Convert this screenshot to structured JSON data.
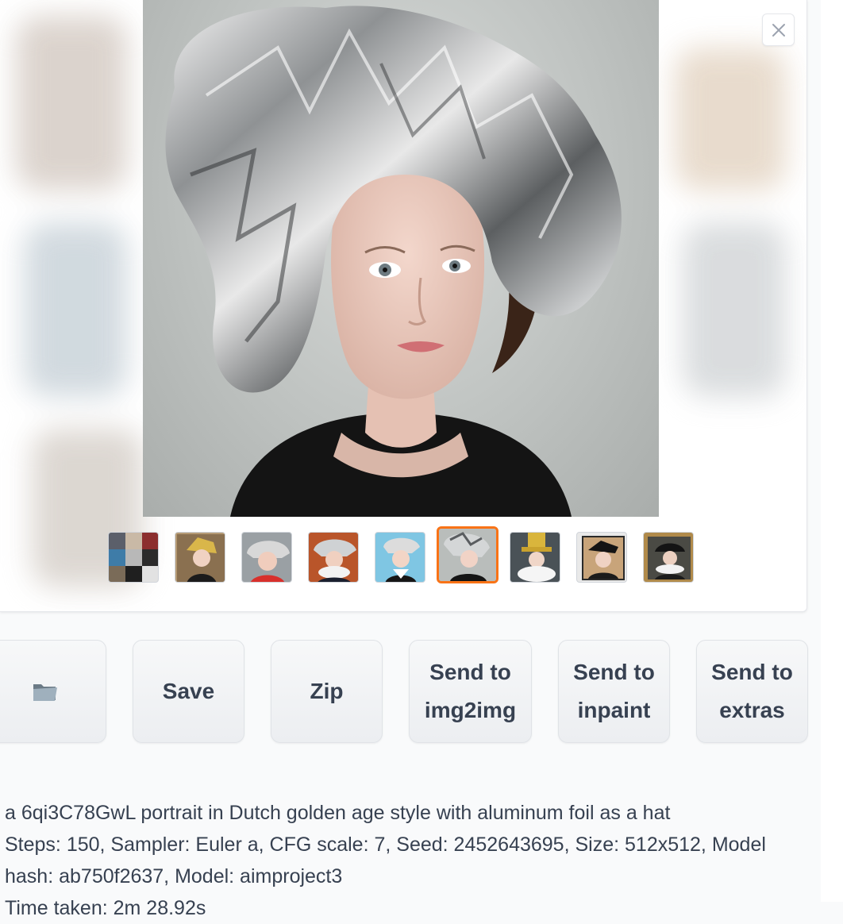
{
  "gallery": {
    "close_icon": "close-icon",
    "thumbnail_count": 9,
    "selected_thumbnail": 6
  },
  "buttons": {
    "open_folder_icon": "folder-icon",
    "save": "Save",
    "zip": "Zip",
    "send_img2img": "Send to\nimg2img",
    "send_inpaint": "Send to\ninpaint",
    "send_extras": "Send to\nextras"
  },
  "info": {
    "prompt": "a 6qi3C78GwL portrait in Dutch golden age style with aluminum foil as a hat",
    "params": "Steps: 150, Sampler: Euler a, CFG scale: 7, Seed: 2452643695, Size: 512x512, Model hash: ab750f2637, Model: aimproject3",
    "time_taken": "Time taken: 2m 28.92s"
  },
  "colors": {
    "accent": "#f97316",
    "background": "#f9fafb",
    "button_text": "#374151"
  }
}
